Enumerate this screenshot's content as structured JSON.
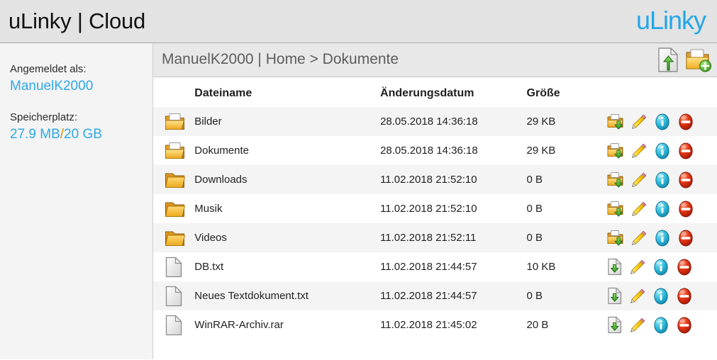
{
  "header": {
    "title": "uLinky | Cloud",
    "brand": "uLinky",
    "brand_color": "#22a7e8"
  },
  "sidebar": {
    "logged_in_label": "Angemeldet als:",
    "username": "ManuelK2000",
    "storage_label": "Speicherplatz:",
    "storage_used": "27.9 MB",
    "storage_separator": "/",
    "storage_total": "20 GB",
    "link_color": "#2fa8e6"
  },
  "breadcrumb": {
    "text": "ManuelK2000 | Home > Dokumente",
    "actions": [
      {
        "name": "upload-file-icon",
        "label": "Datei hochladen"
      },
      {
        "name": "new-folder-icon",
        "label": "Neuer Ordner"
      }
    ]
  },
  "table": {
    "columns": {
      "name": "Dateiname",
      "date": "Änderungsdatum",
      "size": "Größe",
      "actions": ""
    },
    "row_actions": [
      {
        "name": "download-icon",
        "label": "Herunterladen"
      },
      {
        "name": "edit-icon",
        "label": "Umbenennen"
      },
      {
        "name": "info-icon",
        "label": "Informationen"
      },
      {
        "name": "delete-icon",
        "label": "Löschen"
      }
    ],
    "rows": [
      {
        "icon": "folder-open-icon",
        "type": "folder",
        "name": "Bilder",
        "date": "28.05.2018 14:36:18",
        "size": "29 KB"
      },
      {
        "icon": "folder-open-icon",
        "type": "folder",
        "name": "Dokumente",
        "date": "28.05.2018 14:36:18",
        "size": "29 KB"
      },
      {
        "icon": "folder-icon",
        "type": "folder",
        "name": "Downloads",
        "date": "11.02.2018 21:52:10",
        "size": "0 B"
      },
      {
        "icon": "folder-icon",
        "type": "folder",
        "name": "Musik",
        "date": "11.02.2018 21:52:10",
        "size": "0 B"
      },
      {
        "icon": "folder-icon",
        "type": "folder",
        "name": "Videos",
        "date": "11.02.2018 21:52:11",
        "size": "0 B"
      },
      {
        "icon": "file-icon",
        "type": "file",
        "name": "DB.txt",
        "date": "11.02.2018 21:44:57",
        "size": "10 KB"
      },
      {
        "icon": "file-icon",
        "type": "file",
        "name": "Neues Textdokument.txt",
        "date": "11.02.2018 21:44:57",
        "size": "0 B"
      },
      {
        "icon": "file-icon",
        "type": "file",
        "name": "WinRAR-Archiv.rar",
        "date": "11.02.2018 21:45:02",
        "size": "20 B"
      }
    ]
  },
  "colors": {
    "header_bg": "#e3e3e3",
    "sidebar_bg": "#f4f4f4",
    "crumb_bg": "#e8e8e8",
    "row_stripe": "#f4f4f4",
    "folder": "#f0b323",
    "info": "#2fb8d4",
    "delete": "#cc2200",
    "green_arrow": "#38a12a"
  }
}
